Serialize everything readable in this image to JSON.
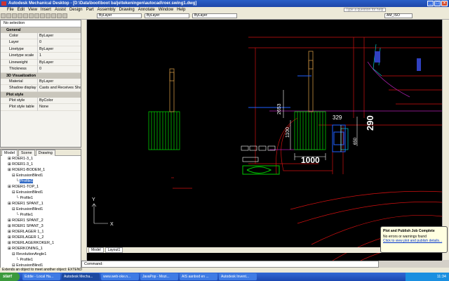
{
  "window": {
    "title": "Autodesk Mechanical Desktop - [D:\\Data\\boot\\boot balje\\tekeningen\\autocad\\roer.swing1.dwg]"
  },
  "menu": [
    "File",
    "Edit",
    "View",
    "Insert",
    "Assist",
    "Design",
    "Part",
    "Assembly",
    "Drawing",
    "Annotate",
    "Window",
    "Help"
  ],
  "menu_full": [
    "File",
    "Edit",
    "View",
    "Insert",
    "Assist",
    "Design",
    "Part",
    "Assembly",
    "Drawing",
    "Annotate",
    "Window",
    "Help"
  ],
  "search": {
    "placeholder": "Type a question for help"
  },
  "toolbar": {
    "layer_combo": "ByLayer",
    "linetype_combo": "ByLayer",
    "lineweight_combo": "ByLayer",
    "style_combo": "AM_ISO"
  },
  "palette": {
    "selection": "No selection",
    "sections": [
      {
        "title": "General",
        "rows": [
          {
            "k": "Color",
            "v": "ByLayer"
          },
          {
            "k": "Layer",
            "v": "0"
          },
          {
            "k": "Linetype",
            "v": "ByLayer"
          },
          {
            "k": "Linetype scale",
            "v": "1"
          },
          {
            "k": "Lineweight",
            "v": "ByLayer"
          },
          {
            "k": "Thickness",
            "v": "0"
          }
        ]
      },
      {
        "title": "3D Visualization",
        "rows": [
          {
            "k": "Material",
            "v": "ByLayer"
          },
          {
            "k": "Shadow display",
            "v": "Casts and Receives Sha..."
          }
        ]
      },
      {
        "title": "Plot style",
        "rows": [
          {
            "k": "Plot style",
            "v": "ByColor"
          },
          {
            "k": "Plot style table",
            "v": "None"
          }
        ]
      }
    ]
  },
  "tree": {
    "tabs": [
      "Model",
      "Scene",
      "Drawing"
    ],
    "nodes": [
      {
        "label": "ROER1-3_1",
        "indent": 1,
        "sel": false
      },
      {
        "label": "ROER1-3_1",
        "indent": 1,
        "sel": false
      },
      {
        "label": "ROER1-BODEM_1",
        "indent": 1,
        "sel": false
      },
      {
        "label": "ExtrusionBlind1",
        "indent": 2,
        "sel": false
      },
      {
        "label": "Profile1",
        "indent": 3,
        "sel": true
      },
      {
        "label": "ROER1-TOP_1",
        "indent": 1,
        "sel": false
      },
      {
        "label": "ExtrusionBlind1",
        "indent": 2,
        "sel": false
      },
      {
        "label": "Profile1",
        "indent": 3,
        "sel": false
      },
      {
        "label": "ROER1 SPANT_1",
        "indent": 1,
        "sel": false
      },
      {
        "label": "ExtrusionBlind1",
        "indent": 2,
        "sel": false
      },
      {
        "label": "Profile1",
        "indent": 3,
        "sel": false
      },
      {
        "label": "ROER1 SPANT_2",
        "indent": 1,
        "sel": false
      },
      {
        "label": "ROER1 SPANT_3",
        "indent": 1,
        "sel": false
      },
      {
        "label": "ROERLAGER 1_1",
        "indent": 1,
        "sel": false
      },
      {
        "label": "ROERLAGER 1_2",
        "indent": 1,
        "sel": false
      },
      {
        "label": "ROERLAGERKOKER_1",
        "indent": 1,
        "sel": false
      },
      {
        "label": "ROERKONING_1",
        "indent": 1,
        "sel": false
      },
      {
        "label": "RevolutionAngle1",
        "indent": 2,
        "sel": false
      },
      {
        "label": "Profile1",
        "indent": 3,
        "sel": false
      },
      {
        "label": "ExtrusionBlind1",
        "indent": 2,
        "sel": false
      }
    ]
  },
  "drawing": {
    "dims": [
      "2653",
      "329",
      "290",
      "1100",
      "650",
      "1000"
    ],
    "axis_x": "X",
    "axis_y": "Y"
  },
  "layout_tabs": [
    "Model",
    "Layout1"
  ],
  "command": {
    "text": "Command:"
  },
  "status": {
    "text": "Extends an object to meet another object: EXTEND"
  },
  "taskbar": {
    "start": "start",
    "tasks": [
      "Eddie - Local Ha...",
      "Autodesk Mecha...",
      "www.web-oke.n...",
      "JavaPop - Mozi...",
      "AIS aanbod en ...",
      "Autodesk Invent..."
    ],
    "clock": "11:34"
  },
  "balloon": {
    "title": "Plot and Publish Job Complete",
    "body": "No errors or warnings found",
    "link": "Click to view plot and publish details..."
  },
  "colors": {
    "canvas": "#000000",
    "green": "#00c800",
    "red": "#d01010",
    "cyan": "#00c8c8",
    "blue": "#2060ff"
  }
}
